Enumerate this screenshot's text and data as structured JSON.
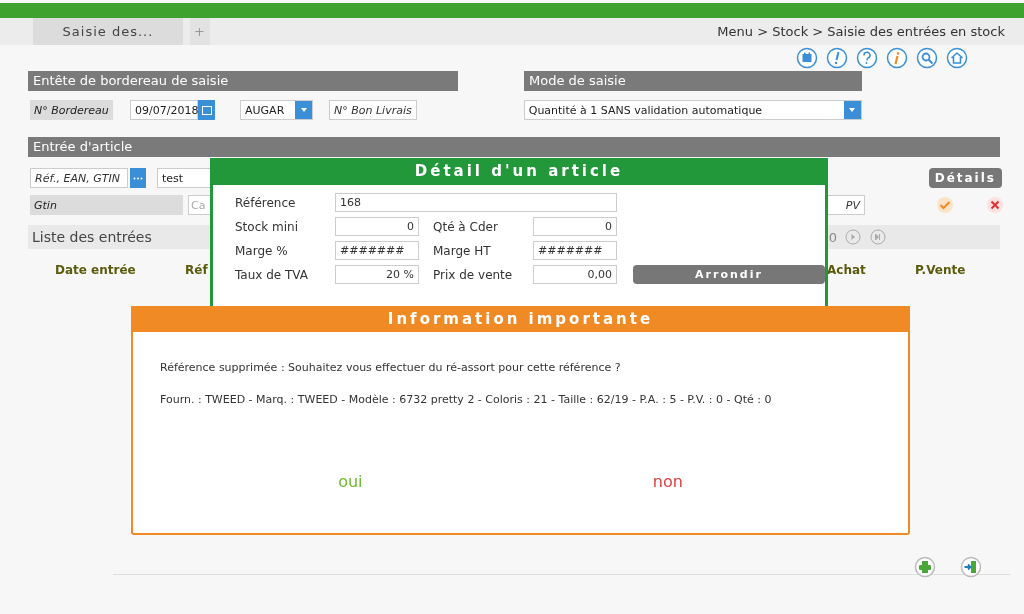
{
  "tabs": [
    {
      "label": "Saisie des...",
      "selected": true
    },
    {
      "label": "+",
      "selected": false
    }
  ],
  "breadcrumb": "Menu > Stock > Saisie des entrées en stock",
  "header_section": {
    "title": "Entête de bordereau de saisie",
    "bordereau_label": "N° Bordereau",
    "date": "09/07/2018",
    "supplier": "AUGAR",
    "delivery_note_placeholder": "N° Bon Livrais"
  },
  "mode_section": {
    "title": "Mode de saisie",
    "mode": "Quantité à 1 SANS validation automatique"
  },
  "article_section": {
    "title": "Entrée d'article",
    "ref_placeholder": "Réf., EAN, GTIN",
    "search_value": "test",
    "gtin_label": "Gtin",
    "category_placeholder": "Ca",
    "details_button": "Détails",
    "price_placeholder": "PV"
  },
  "entries": {
    "title": "Liste des entrées",
    "page": "0",
    "columns": [
      "Date entrée",
      "Réf",
      "Achat",
      "P.Vente"
    ]
  },
  "detail_dialog": {
    "title": "Détail d'un article",
    "round_button": "Arrondir",
    "rows": [
      [
        {
          "label": "Référence",
          "value": "168",
          "kind": "text"
        }
      ],
      [
        {
          "label": "Stock mini",
          "value": "0",
          "kind": "number"
        },
        {
          "label": "Qté à Cder",
          "value": "0",
          "kind": "number"
        }
      ],
      [
        {
          "label": "Marge %",
          "value": "#######",
          "kind": "text"
        },
        {
          "label": "Marge HT",
          "value": "#######",
          "kind": "text"
        }
      ],
      [
        {
          "label": "Taux de TVA",
          "value": "20 %",
          "kind": "number"
        },
        {
          "label": "Prix de vente",
          "value": "0,00",
          "kind": "number"
        }
      ]
    ]
  },
  "info_dialog": {
    "title": "Information importante",
    "message": "Référence supprimée : Souhaitez vous effectuer du ré-assort pour cette référence ?",
    "details": "Fourn. : TWEED - Marq. : TWEED - Modèle : 6732 pretty 2 - Coloris : 21 - Taille : 62/19 - P.A. : 5 - P.V. : 0 - Qté : 0",
    "buttons": [
      {
        "label": "oui",
        "kind": "yes"
      },
      {
        "label": "non",
        "kind": "no"
      }
    ]
  }
}
